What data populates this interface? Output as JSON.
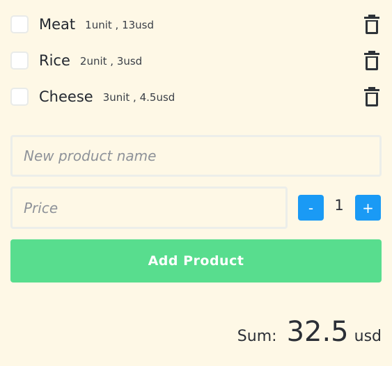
{
  "products": [
    {
      "name": "Meat",
      "meta": "1unit , 13usd"
    },
    {
      "name": "Rice",
      "meta": "2unit , 3usd"
    },
    {
      "name": "Cheese",
      "meta": "3unit , 4.5usd"
    }
  ],
  "form": {
    "name_placeholder": "New product name",
    "price_placeholder": "Price",
    "minus_label": "-",
    "plus_label": "+",
    "quantity": "1",
    "add_label": "Add Product"
  },
  "summary": {
    "label": "Sum:",
    "value": "32.5",
    "unit": "usd"
  },
  "icons": {
    "delete": "trash-icon"
  },
  "colors": {
    "background": "#fef8e6",
    "stepper": "#1a9af5",
    "add_button": "#58dd8e",
    "trash": "#2e3338"
  }
}
